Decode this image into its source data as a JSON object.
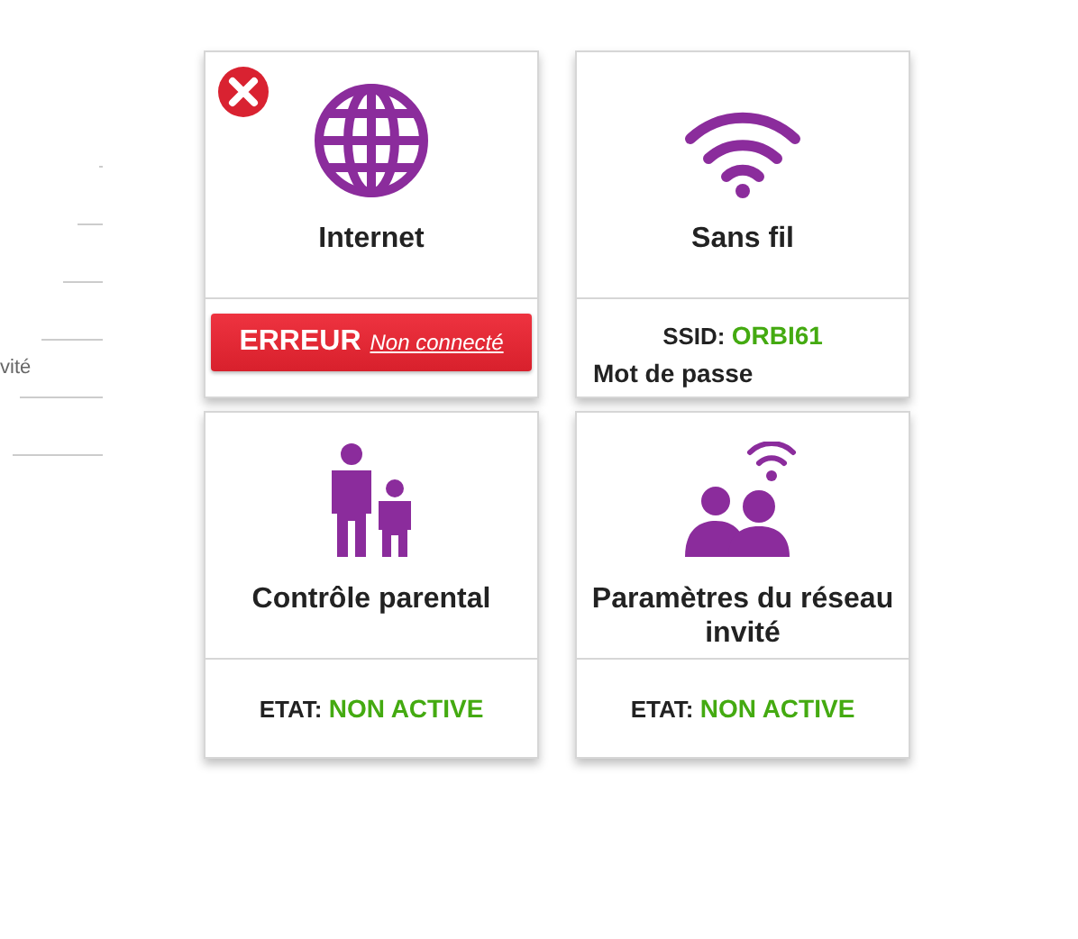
{
  "sidebar": {
    "items": [
      {
        "label": "vité"
      }
    ]
  },
  "tiles": [
    {
      "kind": "internet",
      "title": "Internet",
      "error": true,
      "footer": {
        "kind": "error",
        "label": "ERREUR",
        "link": "Non connecté"
      }
    },
    {
      "kind": "wireless",
      "title": "Sans fil",
      "error": false,
      "footer": {
        "kind": "ssid",
        "label": "SSID:",
        "value": "ORBI61",
        "extra": "Mot de passe"
      }
    },
    {
      "kind": "parental",
      "title": "Contrôle parental",
      "error": false,
      "footer": {
        "kind": "state",
        "label": "ETAT:",
        "value": "NON ACTIVE"
      }
    },
    {
      "kind": "guest",
      "title": "Paramètres du réseau invité",
      "error": false,
      "footer": {
        "kind": "state",
        "label": "ETAT:",
        "value": "NON ACTIVE"
      }
    }
  ]
}
